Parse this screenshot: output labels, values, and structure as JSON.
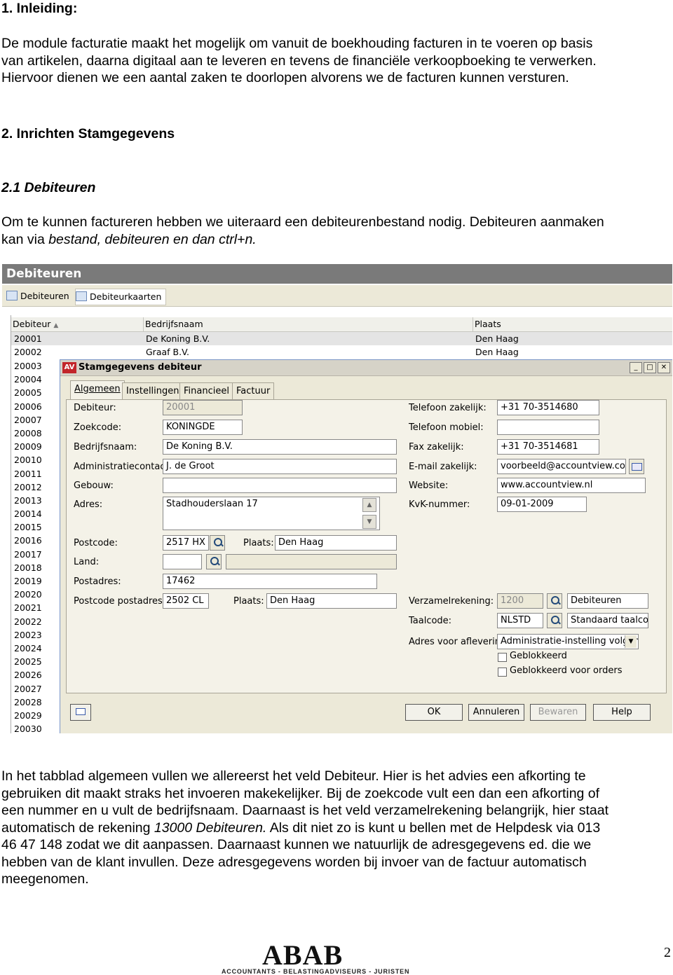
{
  "doc": {
    "h1": "1. Inleiding:",
    "intro_lines": [
      "De module facturatie maakt het mogelijk om vanuit de boekhouding facturen in te voeren op basis",
      "van artikelen, daarna digitaal aan te leveren en tevens de financiële verkoopboeking te verwerken.",
      "Hiervoor dienen we een aantal zaken te doorlopen alvorens we de facturen kunnen versturen."
    ],
    "h2": "2. Inrichten Stamgegevens",
    "h3": "2.1 Debiteuren",
    "para2_line1": "Om te kunnen factureren hebben we uiteraard een debiteurenbestand nodig. Debiteuren aanmaken",
    "para2_line2_a": "kan via ",
    "para2_line2_b": "bestand, debiteuren en dan ctrl+n.",
    "body_lines": [
      "In het tabblad algemeen vullen we allereerst het veld Debiteur. Hier is het advies een afkorting te",
      "gebruiken dit maakt straks het invoeren makekelijker. Bij de zoekcode vult een dan een afkorting of",
      "een nummer en u vult de bedrijfsnaam. Daarnaast is het veld verzamelrekening belangrijk, hier staat"
    ],
    "body_line4_a": "automatisch de rekening ",
    "body_line4_b": "13000 Debiteuren.",
    "body_line4_c": " Als dit niet zo is kunt u bellen met de Helpdesk via 013",
    "body_lines_end": [
      "46 47 148 zodat we dit aanpassen. Daarnaast kunnen we natuurlijk de adresgegevens ed. die we",
      "hebben van de klant invullen. Deze adresgegevens worden bij invoer van de factuur automatisch",
      "meegenomen."
    ],
    "page_number": "2"
  },
  "logo": {
    "main": "ABAB",
    "sub": "ACCOUNTANTS - BELASTINGADVISEURS - JURISTEN"
  },
  "screenshot": {
    "window_title": "Debiteuren",
    "toolbar_tabs": [
      "Debiteuren",
      "Debiteurkaarten"
    ],
    "grid": {
      "columns": [
        "Debiteur",
        "Bedrijfsnaam",
        "Plaats"
      ],
      "rows": [
        {
          "debiteur": "20001",
          "bedrijfsnaam": "De Koning B.V.",
          "plaats": "Den Haag"
        },
        {
          "debiteur": "20002",
          "bedrijfsnaam": "Graaf B.V.",
          "plaats": "Den Haag"
        }
      ],
      "more_ids": [
        "20003",
        "20004",
        "20005",
        "20006",
        "20007",
        "20008",
        "20009",
        "20010",
        "20011",
        "20012",
        "20013",
        "20014",
        "20015",
        "20016",
        "20017",
        "20018",
        "20019",
        "20020",
        "20021",
        "20022",
        "20023",
        "20024",
        "20025",
        "20026",
        "20027",
        "20028",
        "20029",
        "20030"
      ]
    },
    "dialog": {
      "logo": "AV",
      "title": "Stamgegevens debiteur",
      "tabs": [
        "Algemeen",
        "Instellingen",
        "Financieel",
        "Factuur"
      ],
      "labels": {
        "debiteur": "Debiteur:",
        "zoekcode": "Zoekcode:",
        "bedrijfsnaam": "Bedrijfsnaam:",
        "administratiecontact": "Administratiecontact:",
        "gebouw": "Gebouw:",
        "adres": "Adres:",
        "postcode": "Postcode:",
        "plaats": "Plaats:",
        "land": "Land:",
        "postadres": "Postadres:",
        "postcode_postadres": "Postcode postadres",
        "plaats2": "Plaats:",
        "tel_zakelijk": "Telefoon zakelijk:",
        "tel_mobiel": "Telefoon mobiel:",
        "fax": "Fax zakelijk:",
        "email": "E-mail zakelijk:",
        "website": "Website:",
        "kvk": "KvK-nummer:",
        "verzamelrekening": "Verzamelrekening:",
        "taalcode": "Taalcode:",
        "adres_aflevering": "Adres voor aflevering:"
      },
      "values": {
        "debiteur": "20001",
        "zoekcode": "KONINGDE",
        "bedrijfsnaam": "De Koning B.V.",
        "administratiecontact": "J. de Groot",
        "gebouw": "",
        "adres": "Stadhouderslaan 17",
        "postcode": "2517 HX",
        "plaats": "Den Haag",
        "land": "",
        "land_name": "",
        "postadres": "17462",
        "postcode_postadres": "2502 CL",
        "plaats2": "Den Haag",
        "tel_zakelijk": "+31 70-3514680",
        "tel_mobiel": "",
        "fax": "+31 70-3514681",
        "email": "voorbeeld@accountview.com",
        "website": "www.accountview.nl",
        "kvk": "09-01-2009",
        "verzamelrekening": "1200",
        "verzamelrekening_name": "Debiteuren",
        "taalcode": "NLSTD",
        "taalcode_name": "Standaard taalcode",
        "adres_aflevering": "Administratie-instelling volgen"
      },
      "checkboxes": {
        "geblokkeerd": "Geblokkeerd",
        "geblokkeerd_orders": "Geblokkeerd voor orders"
      },
      "buttons": {
        "ok": "OK",
        "annuleren": "Annuleren",
        "bewaren": "Bewaren",
        "help": "Help"
      }
    }
  }
}
